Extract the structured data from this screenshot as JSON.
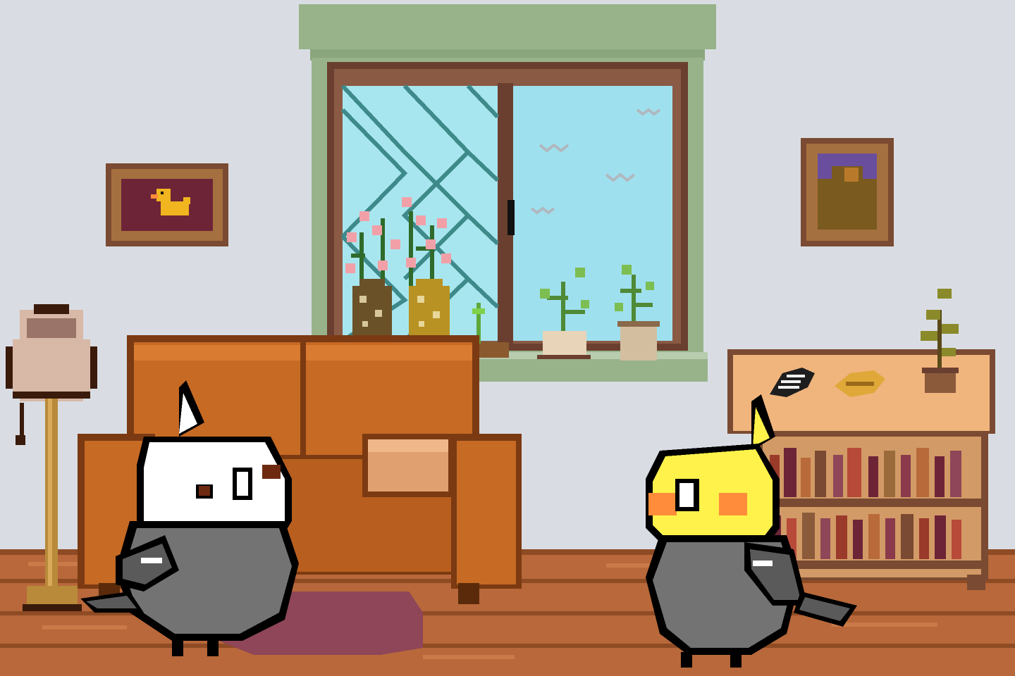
{
  "scene": {
    "type": "pixel-art room",
    "colors": {
      "wall": "#d9dde3",
      "floor": "#b8683a",
      "floor_dark": "#8f4b24",
      "window_frame": "#98b38a",
      "window_inner_frame": "#6b3f2f",
      "sky": "#9fe0ee",
      "sofa": "#c66a24",
      "sofa_dark": "#7b3a12",
      "rug": "#8e4658",
      "shelf": "#f0b57d",
      "shelf_dark": "#7a4a32",
      "bird_gray": "#737373",
      "bird_white": "#ffffff",
      "bird_yellow": "#fff24a",
      "cheek_orange": "#ff8c3a",
      "duck_yellow": "#f0b51f",
      "frame_wood": "#7a4a32",
      "frame_inner": "#6e2437"
    },
    "items": [
      "window",
      "left-picture-frame",
      "right-picture-frame",
      "floor-lamp",
      "sofa",
      "rug",
      "bookshelf",
      "sunflower-seed",
      "millet-seed",
      "potted-plant",
      "flower-vases",
      "white-cockatiel",
      "yellow-cockatiel"
    ]
  }
}
